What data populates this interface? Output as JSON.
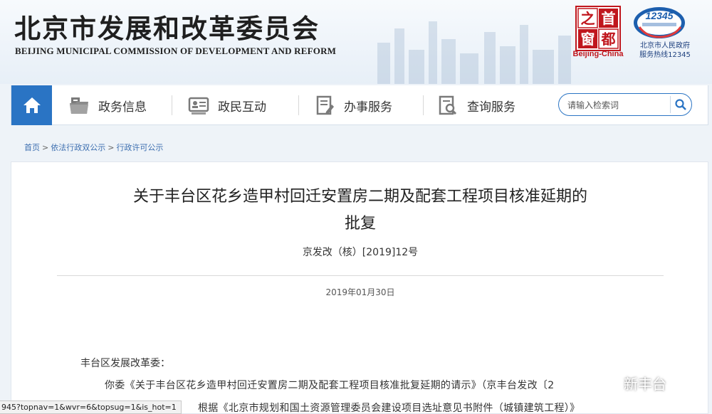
{
  "header": {
    "title_cn": "北京市发展和改革委员会",
    "title_en": "BEIJING MUNICIPAL COMMISSION OF DEVELOPMENT AND REFORM",
    "seal_caption": "Beijing-China",
    "hotline_number": "12345",
    "hotline_line1": "北京市人民政府",
    "hotline_line2": "服务热线12345"
  },
  "nav": {
    "items": [
      {
        "label": "政务信息",
        "icon": "folder-icon"
      },
      {
        "label": "政民互动",
        "icon": "id-card-icon"
      },
      {
        "label": "办事服务",
        "icon": "document-edit-icon"
      },
      {
        "label": "查询服务",
        "icon": "search-document-icon"
      }
    ],
    "search_placeholder": "请输入检索词"
  },
  "breadcrumb": [
    "首页",
    "依法行政双公示",
    "行政许可公示"
  ],
  "article": {
    "title_line1": "关于丰台区花乡造甲村回迁安置房二期及配套工程项目核准延期的",
    "title_line2": "批复",
    "doc_number": "京发改（核）[2019]12号",
    "date": "2019年01月30日",
    "addressee": "丰台区发展改革委：",
    "para1": "你委《关于丰台区花乡造甲村回迁安置房二期及配套工程项目核准批复延期的请示》（京丰台发改〔2",
    "para2": "根据《北京市规划和国土资源管理委员会建设项目选址意见书附件（城镇建筑工程）》"
  },
  "status_url": "945?topnav=1&wvr=6&topsug=1&is_hot=1",
  "watermark": "新丰台",
  "colors": {
    "nav_blue": "#2a74c4",
    "brand_red": "#c0161d",
    "link_blue": "#3d6fb0"
  }
}
